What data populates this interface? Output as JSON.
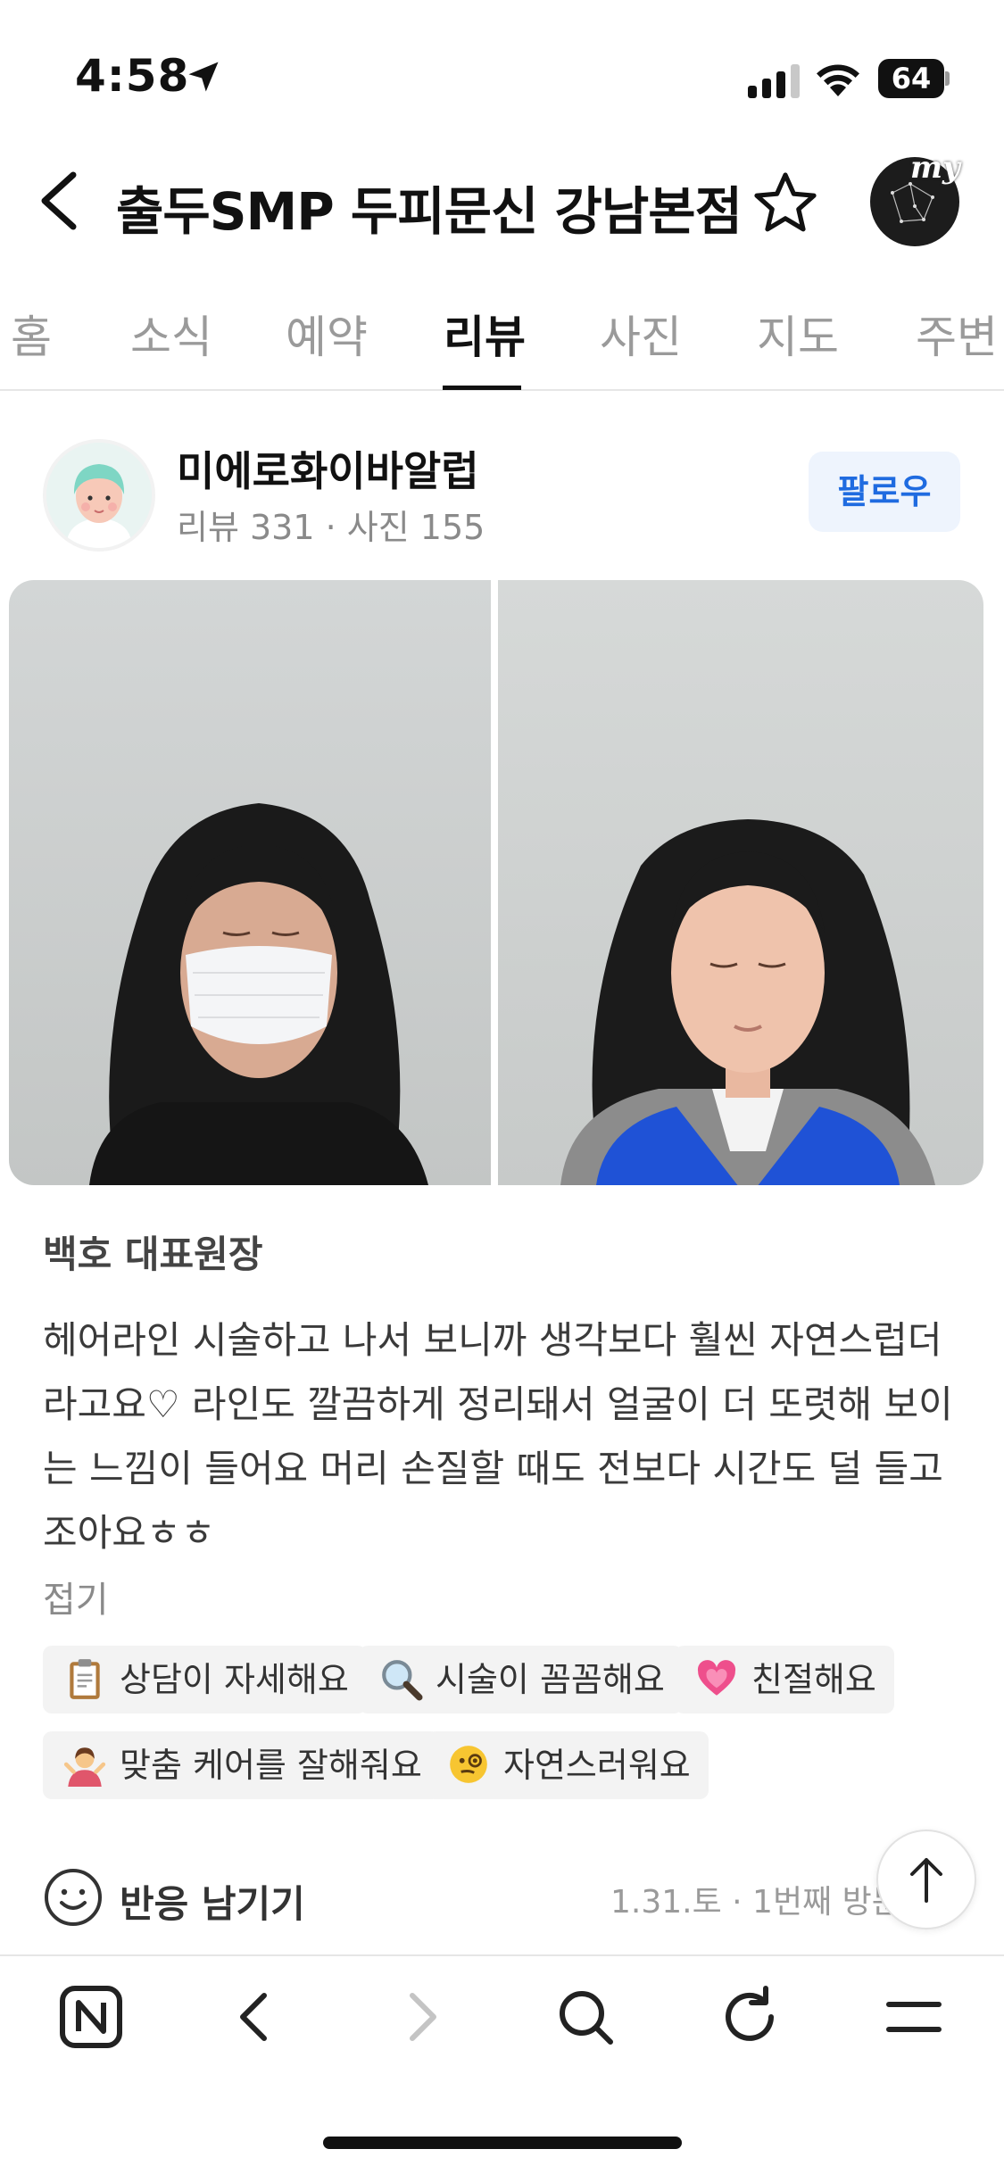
{
  "status_bar": {
    "time": "4:58",
    "battery": "64"
  },
  "header": {
    "title": "출두SMP 두피문신 강남본점",
    "my_label": "my"
  },
  "tabs": [
    {
      "label": "홈"
    },
    {
      "label": "소식"
    },
    {
      "label": "예약"
    },
    {
      "label": "리뷰",
      "active": true
    },
    {
      "label": "사진"
    },
    {
      "label": "지도"
    },
    {
      "label": "주변"
    }
  ],
  "reviewer": {
    "name": "미에로화이바알럽",
    "stats": "리뷰 331 · 사진 155",
    "follow_label": "팔로우"
  },
  "review": {
    "business_reply_author": "백호 대표원장",
    "text": "헤어라인 시술하고 나서 보니까 생각보다 훨씬 자연스럽더라고요♡ 라인도 깔끔하게 정리돼서 얼굴이 더 또렷해 보이는 느낌이 들어요 머리 손질할 때도 전보다 시간도 덜 들고 조아요ㅎㅎ",
    "collapse_label": "접기",
    "keywords": [
      {
        "label": "상담이 자세해요",
        "icon": "clipboard-icon"
      },
      {
        "label": "시술이 꼼꼼해요",
        "icon": "magnifier-icon"
      },
      {
        "label": "친절해요",
        "icon": "heart-icon"
      },
      {
        "label": "맞춤 케어를 잘해줘요",
        "icon": "person-gesture-icon"
      },
      {
        "label": "자연스러워요",
        "icon": "monocle-face-icon"
      }
    ],
    "reaction_label": "반응 남기기",
    "visit_info": "1.31.토 · 1번째 방문"
  },
  "colors": {
    "accent": "#1f6be0",
    "follow_bg": "#eef4fd",
    "chip_bg": "#f3f3f3"
  }
}
